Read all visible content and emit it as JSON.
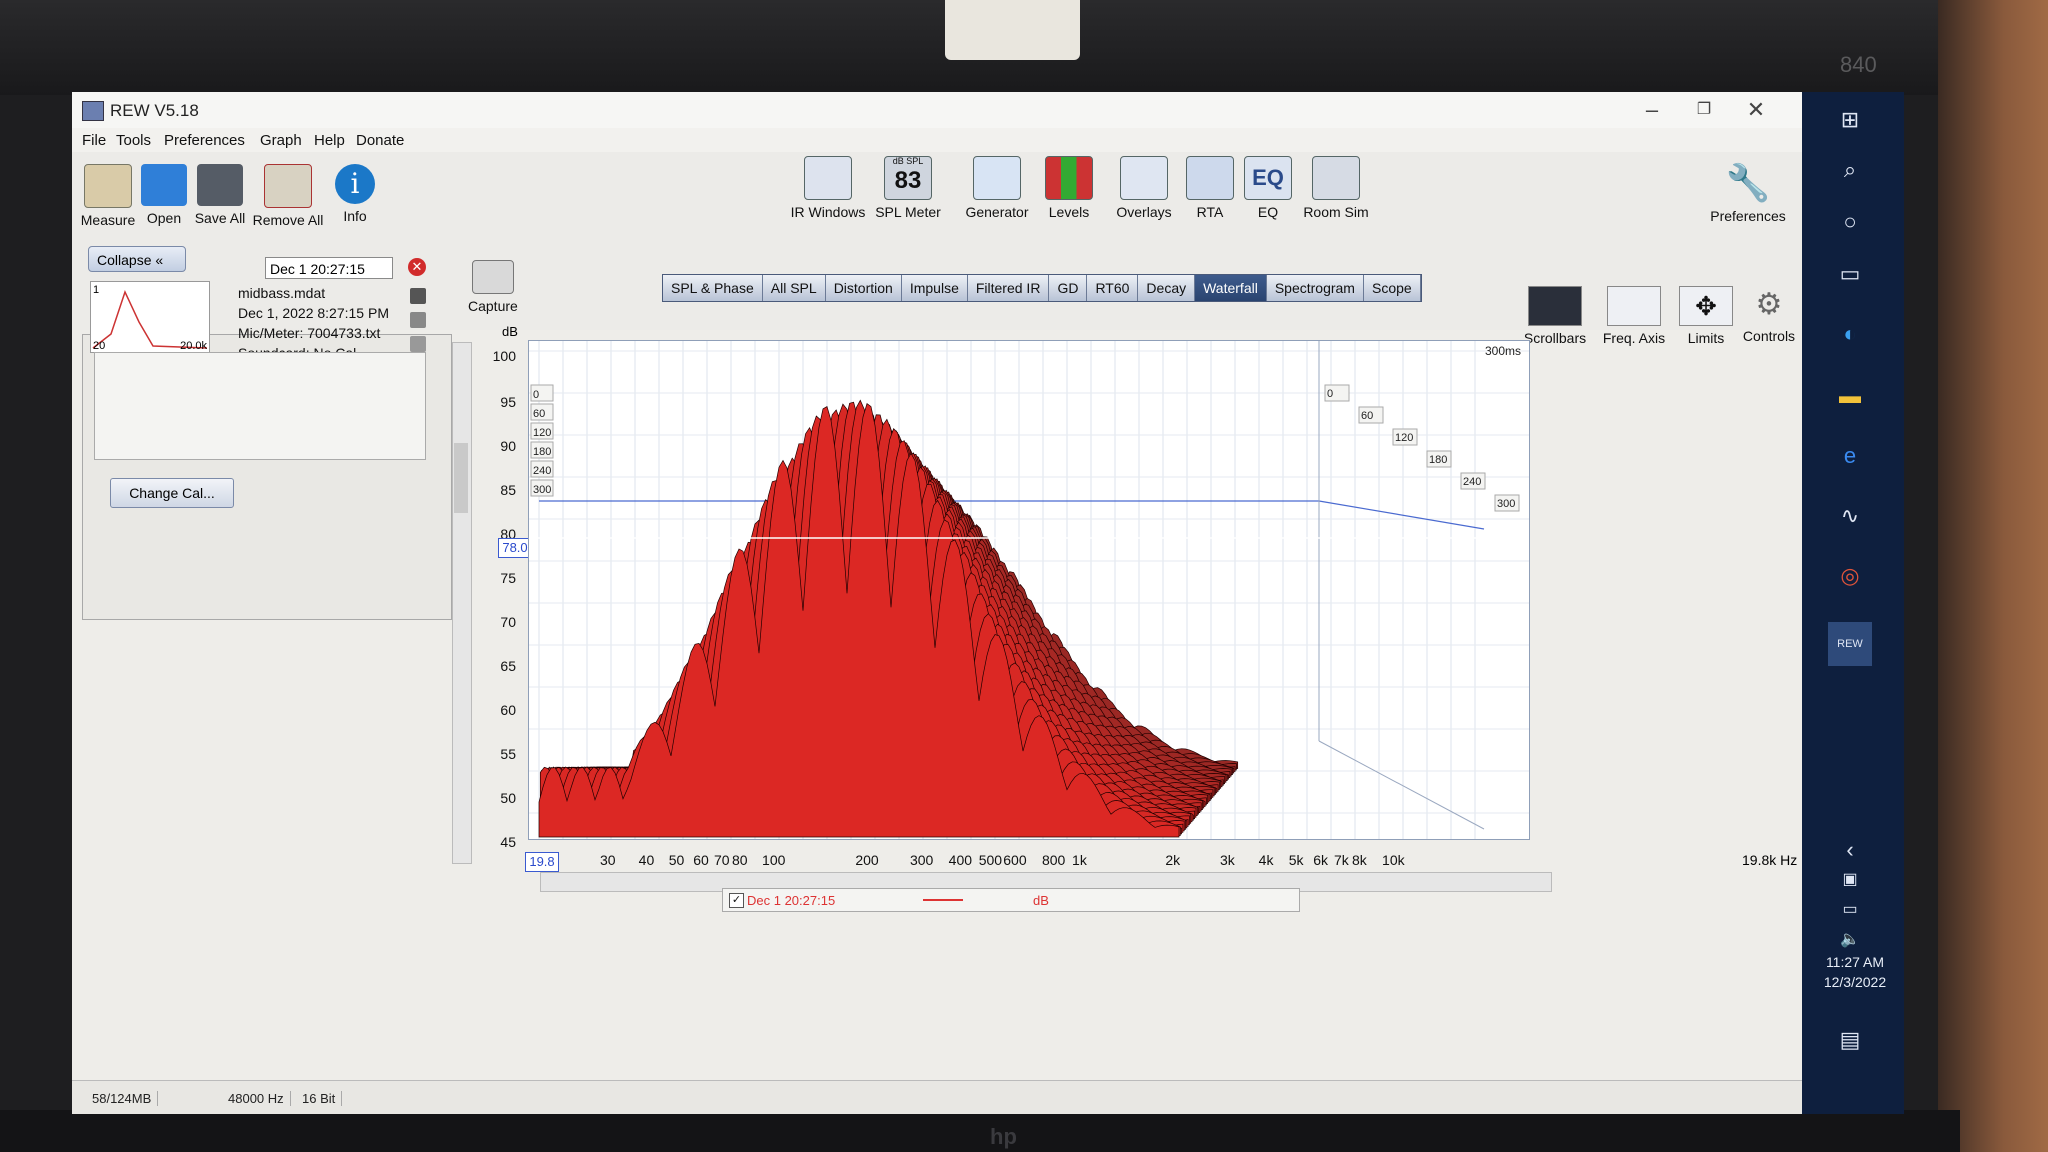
{
  "window": {
    "title": "REW V5.18"
  },
  "menu": [
    "File",
    "Tools",
    "Preferences",
    "Graph",
    "Help",
    "Donate"
  ],
  "toolbar_left": [
    "Measure",
    "Open",
    "Save All",
    "Remove All",
    "Info"
  ],
  "toolbar_center": [
    "IR Windows",
    "SPL Meter",
    "Generator",
    "Levels",
    "Overlays",
    "RTA",
    "EQ",
    "Room Sim"
  ],
  "spl_meter_reading": "83",
  "spl_meter_unit": "dB SPL",
  "preferences_label": "Preferences",
  "graph_tabs": [
    "SPL & Phase",
    "All SPL",
    "Distortion",
    "Impulse",
    "Filtered IR",
    "GD",
    "RT60",
    "Decay",
    "Waterfall",
    "Spectrogram",
    "Scope"
  ],
  "active_tab": "Waterfall",
  "view_controls": [
    "Scrollbars",
    "Freq. Axis",
    "Limits",
    "Controls"
  ],
  "panel": {
    "collapse": "Collapse",
    "measurement_name": "Dec 1 20:27:15",
    "file": "midbass.mdat",
    "date": "Dec 1, 2022 8:27:15 PM",
    "mic": "Mic/Meter: 7004733.txt",
    "soundcard": "Soundcard: No Cal",
    "thumb_left": "20",
    "thumb_right": "20.0k",
    "thumb_top": "1",
    "change_cal": "Change Cal..."
  },
  "capture_label": "Capture",
  "y_unit": "dB",
  "y_ticks": [
    "100",
    "95",
    "90",
    "85",
    "80",
    "75",
    "70",
    "65",
    "60",
    "55",
    "50",
    "45"
  ],
  "cursor_value": "78.0",
  "x_start": "19.8",
  "x_ticks": [
    "30",
    "40",
    "50",
    "60",
    "70",
    "80",
    "100",
    "200",
    "300",
    "400",
    "500",
    "600",
    "800",
    "1k",
    "2k",
    "3k",
    "4k",
    "5k",
    "6k",
    "7k",
    "8k",
    "10k"
  ],
  "x_end": "19.8k Hz",
  "time_label": "300ms",
  "time_ticks_front": [
    "0",
    "60",
    "120",
    "180",
    "240",
    "300"
  ],
  "time_ticks_right": [
    "0",
    "60",
    "120",
    "180",
    "240",
    "300"
  ],
  "legend": {
    "name": "Dec 1 20:27:15",
    "unit": "dB"
  },
  "status": [
    "58/124MB",
    "48000 Hz",
    "16 Bit"
  ],
  "clock": {
    "time": "11:27 AM",
    "date": "12/3/2022"
  },
  "bezel_model": "840",
  "colors": {
    "waterfall": "#c8302a",
    "tab_active": "#2e4a7a",
    "taskbar": "#0e1f3e"
  }
}
